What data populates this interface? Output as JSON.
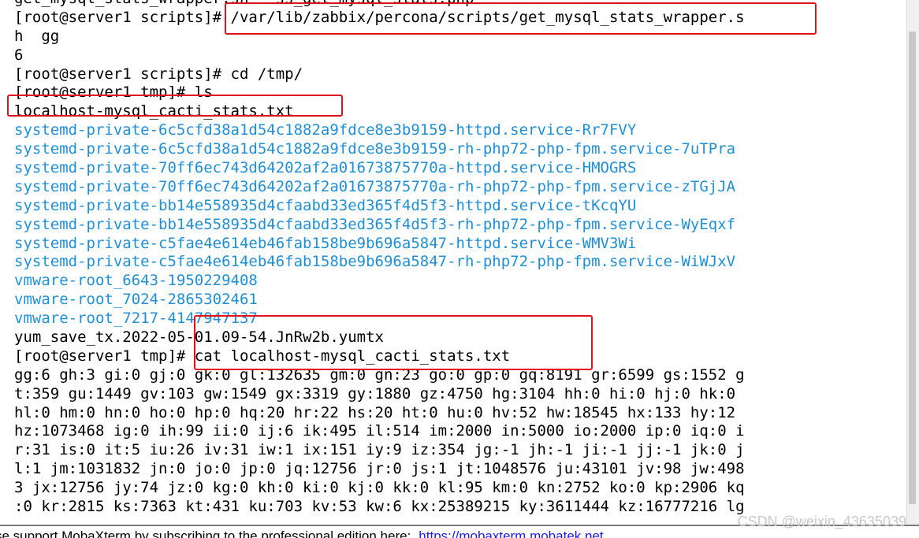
{
  "terminal": {
    "lines": [
      {
        "text": "get_mysql_stats_wrapper.sh   ss_get_mysql_stats.php",
        "color": "black"
      },
      {
        "text": "[root@server1 scripts]# /var/lib/zabbix/percona/scripts/get_mysql_stats_wrapper.s",
        "color": "black"
      },
      {
        "text": "h  gg",
        "color": "black"
      },
      {
        "text": "6",
        "color": "black"
      },
      {
        "text": "[root@server1 scripts]# cd /tmp/",
        "color": "black"
      },
      {
        "text": "[root@server1 tmp]# ls",
        "color": "black"
      },
      {
        "text": "localhost-mysql_cacti_stats.txt",
        "color": "black"
      },
      {
        "text": "systemd-private-6c5cfd38a1d54c1882a9fdce8e3b9159-httpd.service-Rr7FVY",
        "color": "blue"
      },
      {
        "text": "systemd-private-6c5cfd38a1d54c1882a9fdce8e3b9159-rh-php72-php-fpm.service-7uTPra",
        "color": "blue"
      },
      {
        "text": "systemd-private-70ff6ec743d64202af2a01673875770a-httpd.service-HMOGRS",
        "color": "blue"
      },
      {
        "text": "systemd-private-70ff6ec743d64202af2a01673875770a-rh-php72-php-fpm.service-zTGjJA",
        "color": "blue"
      },
      {
        "text": "systemd-private-bb14e558935d4cfaabd33ed365f4d5f3-httpd.service-tKcqYU",
        "color": "blue"
      },
      {
        "text": "systemd-private-bb14e558935d4cfaabd33ed365f4d5f3-rh-php72-php-fpm.service-WyEqxf",
        "color": "blue"
      },
      {
        "text": "systemd-private-c5fae4e614eb46fab158be9b696a5847-httpd.service-WMV3Wi",
        "color": "blue"
      },
      {
        "text": "systemd-private-c5fae4e614eb46fab158be9b696a5847-rh-php72-php-fpm.service-WiWJxV",
        "color": "blue"
      },
      {
        "text": "vmware-root_6643-1950229408",
        "color": "blue"
      },
      {
        "text": "vmware-root_7024-2865302461",
        "color": "blue"
      },
      {
        "text": "vmware-root_7217-4147947137",
        "color": "blue"
      },
      {
        "text": "yum_save_tx.2022-05-01.09-54.JnRw2b.yumtx",
        "color": "black"
      },
      {
        "text": "[root@server1 tmp]# cat localhost-mysql_cacti_stats.txt",
        "color": "black"
      },
      {
        "text": "gg:6 gh:3 gi:0 gj:0 gk:0 gl:132635 gm:0 gn:23 go:0 gp:0 gq:8191 gr:6599 gs:1552 g",
        "color": "black"
      },
      {
        "text": "t:359 gu:1449 gv:103 gw:1549 gx:3319 gy:1880 gz:4750 hg:3104 hh:0 hi:0 hj:0 hk:0",
        "color": "black"
      },
      {
        "text": "hl:0 hm:0 hn:0 ho:0 hp:0 hq:20 hr:22 hs:20 ht:0 hu:0 hv:52 hw:18545 hx:133 hy:12",
        "color": "black"
      },
      {
        "text": "hz:1073468 ig:0 ih:99 ii:0 ij:6 ik:495 il:514 im:2000 in:5000 io:2000 ip:0 iq:0 i",
        "color": "black"
      },
      {
        "text": "r:31 is:0 it:5 iu:26 iv:31 iw:1 ix:151 iy:9 iz:354 jg:-1 jh:-1 ji:-1 jj:-1 jk:0 j",
        "color": "black"
      },
      {
        "text": "l:1 jm:1031832 jn:0 jo:0 jp:0 jq:12756 jr:0 js:1 jt:1048576 ju:43101 jv:98 jw:498",
        "color": "black"
      },
      {
        "text": "3 jx:12756 jy:74 jz:0 kg:0 kh:0 ki:0 kj:0 kk:0 kl:95 km:0 kn:2752 ko:0 kp:2906 kq",
        "color": "black"
      },
      {
        "text": ":0 kr:2815 ks:7363 kt:431 ku:703 kv:53 kw:6 kx:25389215 ky:3611444 kz:16777216 lg",
        "color": "black"
      }
    ]
  },
  "status_bar": {
    "text": "se support MobaXterm by subscribing to the professional edition here:",
    "link": "https://mobaxterm.mobatek.net"
  },
  "watermark": "CSDN @weixin_43635039",
  "colors": {
    "prompt_text": "#000000",
    "directory_text": "#1f8fd6",
    "highlight_box": "#e0121b"
  }
}
